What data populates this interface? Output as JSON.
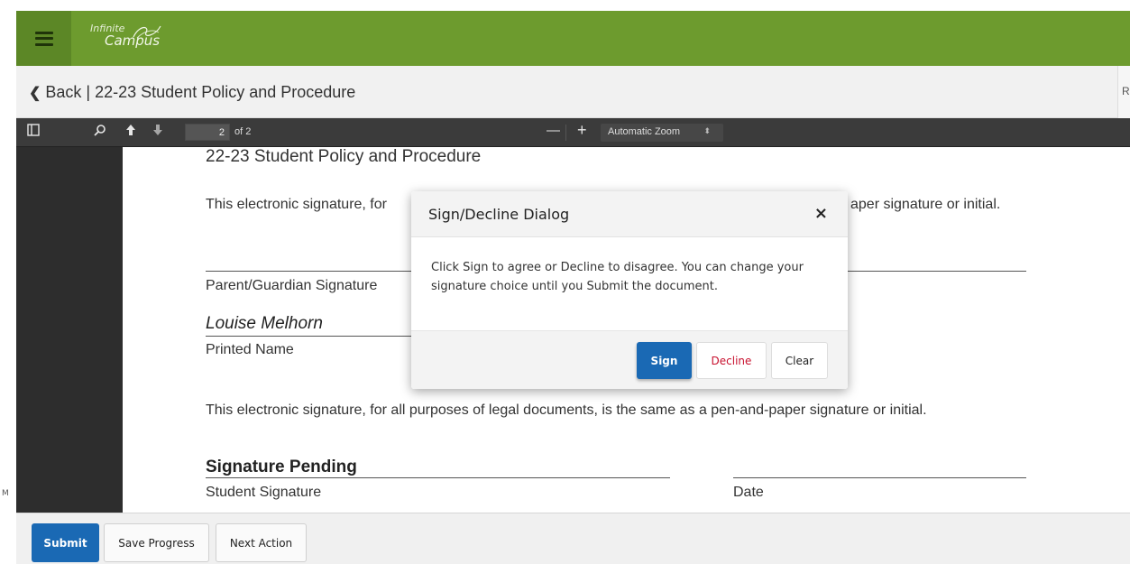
{
  "app": {
    "logo_line1": "Infinite",
    "logo_line2": "Campus",
    "brand_color": "#6d9b2e"
  },
  "backbar": {
    "back_label": "Back | 22-23 Student Policy and Procedure",
    "right_edge_text": "R"
  },
  "gutter": {
    "mark": "M"
  },
  "pdf_toolbar": {
    "current_page": "2",
    "page_of": "of 2",
    "zoom_minus": "—",
    "zoom_plus": "+",
    "zoom_value": "Automatic Zoom",
    "zoom_caret": "⬍",
    "icons": [
      "sidebar-toggle-icon",
      "search-icon",
      "arrow-up-icon",
      "arrow-down-icon"
    ]
  },
  "document": {
    "title": "22-23 Student Policy  and Procedure",
    "esig_text_partial": "This electronic signature, for",
    "esig_text_tail": "aper signature or initial.",
    "parent_signature_label": "Parent/Guardian Signature",
    "printed_name_value": "Louise Melhorn",
    "printed_name_label": "Printed Name",
    "esig_text_full": "This electronic signature, for all purposes of legal documents, is the same as a pen-and-paper signature or initial.",
    "signature_pending": "Signature Pending",
    "student_signature_label": "Student Signature",
    "date_label": "Date"
  },
  "dialog": {
    "title": "Sign/Decline Dialog",
    "close": "×",
    "body": "Click Sign to agree or Decline to disagree. You can change your signature choice until you Submit the document.",
    "sign_label": "Sign",
    "decline_label": "Decline",
    "clear_label": "Clear"
  },
  "bottom_actions": {
    "submit_label": "Submit",
    "save_label": "Save Progress",
    "next_label": "Next Action"
  }
}
